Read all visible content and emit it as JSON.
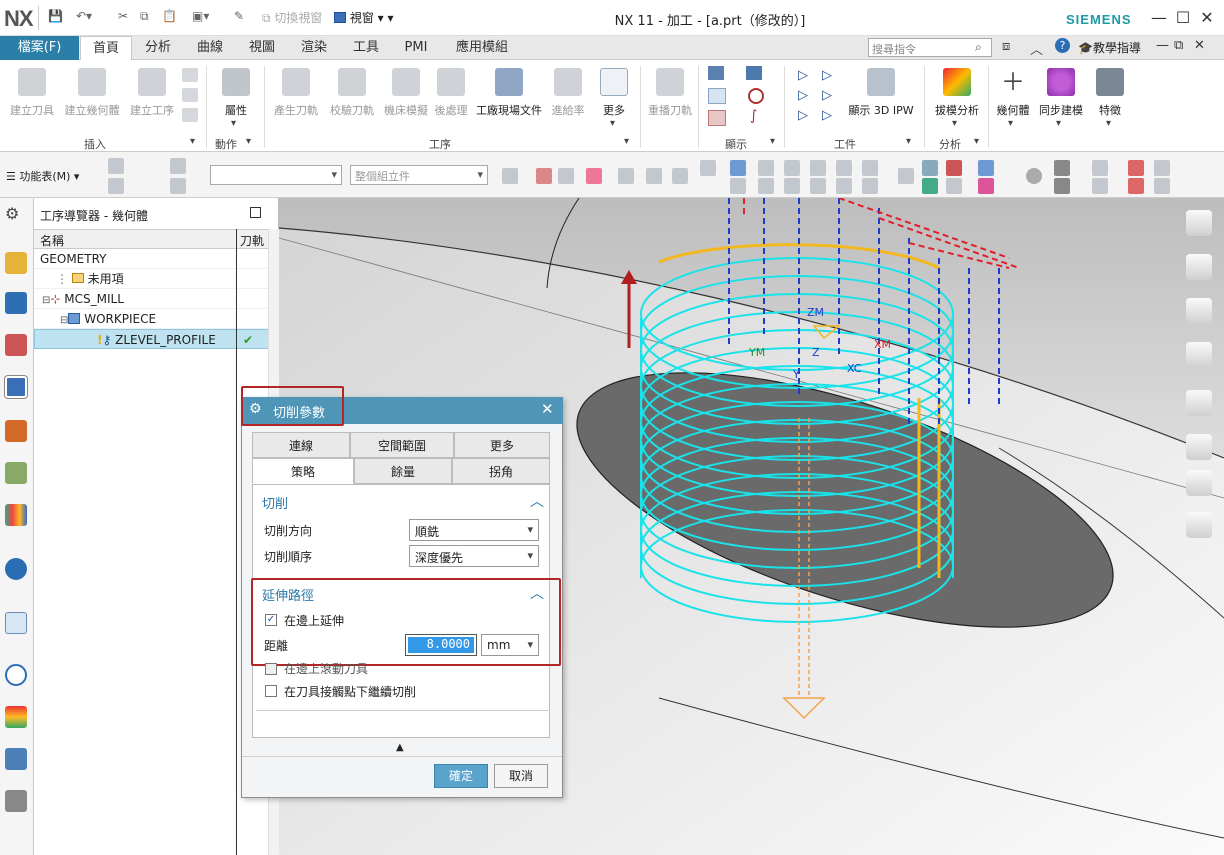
{
  "app": {
    "logo": "NX",
    "title": "NX 11 - 加工 - [a.prt（修改的）]",
    "brand": "SIEMENS"
  },
  "quick_access": {
    "window_switch": "切換視窗",
    "window_menu": "視窗"
  },
  "ribbon_tabs": {
    "file": "檔案(F)",
    "home": "首頁",
    "analysis": "分析",
    "curve": "曲線",
    "view": "視圖",
    "render": "渲染",
    "tools": "工具",
    "pmi": "PMI",
    "app": "應用模組"
  },
  "search": {
    "placeholder": "搜尋指令"
  },
  "help": {
    "guide": "教學指導"
  },
  "ribbon": {
    "insert": {
      "create_tool": "建立刀具",
      "create_geometry": "建立幾何體",
      "create_operation": "建立工序",
      "label": "插入"
    },
    "actions": {
      "properties": "屬性",
      "label": "動作"
    },
    "operations": {
      "generate": "產生刀軌",
      "verify": "校驗刀軌",
      "machine": "機床模擬",
      "post": "後處理",
      "shop_doc": "工廠現場文件",
      "feedrate": "進給率",
      "more": "更多",
      "label": "工序"
    },
    "replay": {
      "label": "重播刀軌"
    },
    "display": {
      "label": "顯示"
    },
    "workpiece": {
      "show_ipw": "顯示 3D IPW",
      "label": "工件"
    },
    "analysis": {
      "draft": "拔模分析",
      "label": "分析"
    },
    "geometry": {
      "label": "幾何體"
    },
    "sync": {
      "label": "同步建模"
    },
    "feature": {
      "label": "特徵"
    }
  },
  "toolbar2": {
    "menu": "功能表(M)",
    "filter_placeholder": "",
    "assembly": "整個組立件"
  },
  "navigator": {
    "title": "工序導覽器 - 幾何體",
    "col_name": "名稱",
    "col_path": "刀軌",
    "rows": [
      {
        "label": "GEOMETRY"
      },
      {
        "label": "未用項"
      },
      {
        "label": "MCS_MILL"
      },
      {
        "label": "WORKPIECE"
      },
      {
        "label": "ZLEVEL_PROFILE",
        "status": "✔"
      }
    ]
  },
  "viewport": {
    "labels": {
      "zm": "ZM",
      "xm": "XM",
      "ym": "YM",
      "z": "Z",
      "y": "Y",
      "xc": "XC"
    }
  },
  "dialog": {
    "title": "切削參數",
    "tabs_row1": [
      "連線",
      "空間範圍",
      "更多"
    ],
    "tabs_row2": [
      "策略",
      "餘量",
      "拐角"
    ],
    "cut_group": "切削",
    "cut_direction_label": "切削方向",
    "cut_direction_value": "順銑",
    "cut_order_label": "切削順序",
    "cut_order_value": "深度優先",
    "extend_group": "延伸路徑",
    "extend_at_edge": "在邊上延伸",
    "distance_label": "距離",
    "distance_value": "8.0000",
    "unit": "mm",
    "roll_tool": "在邊上滾動刀具",
    "continue_cut": "在刀具接觸點下繼續切削",
    "ok": "確定",
    "cancel": "取消"
  },
  "colors": {
    "accent": "#2a7ea7",
    "dialog_header": "#4f95b8",
    "highlight_box": "#b42525",
    "toolpath": "#19e3e8",
    "ok_button": "#5aa4cc"
  }
}
